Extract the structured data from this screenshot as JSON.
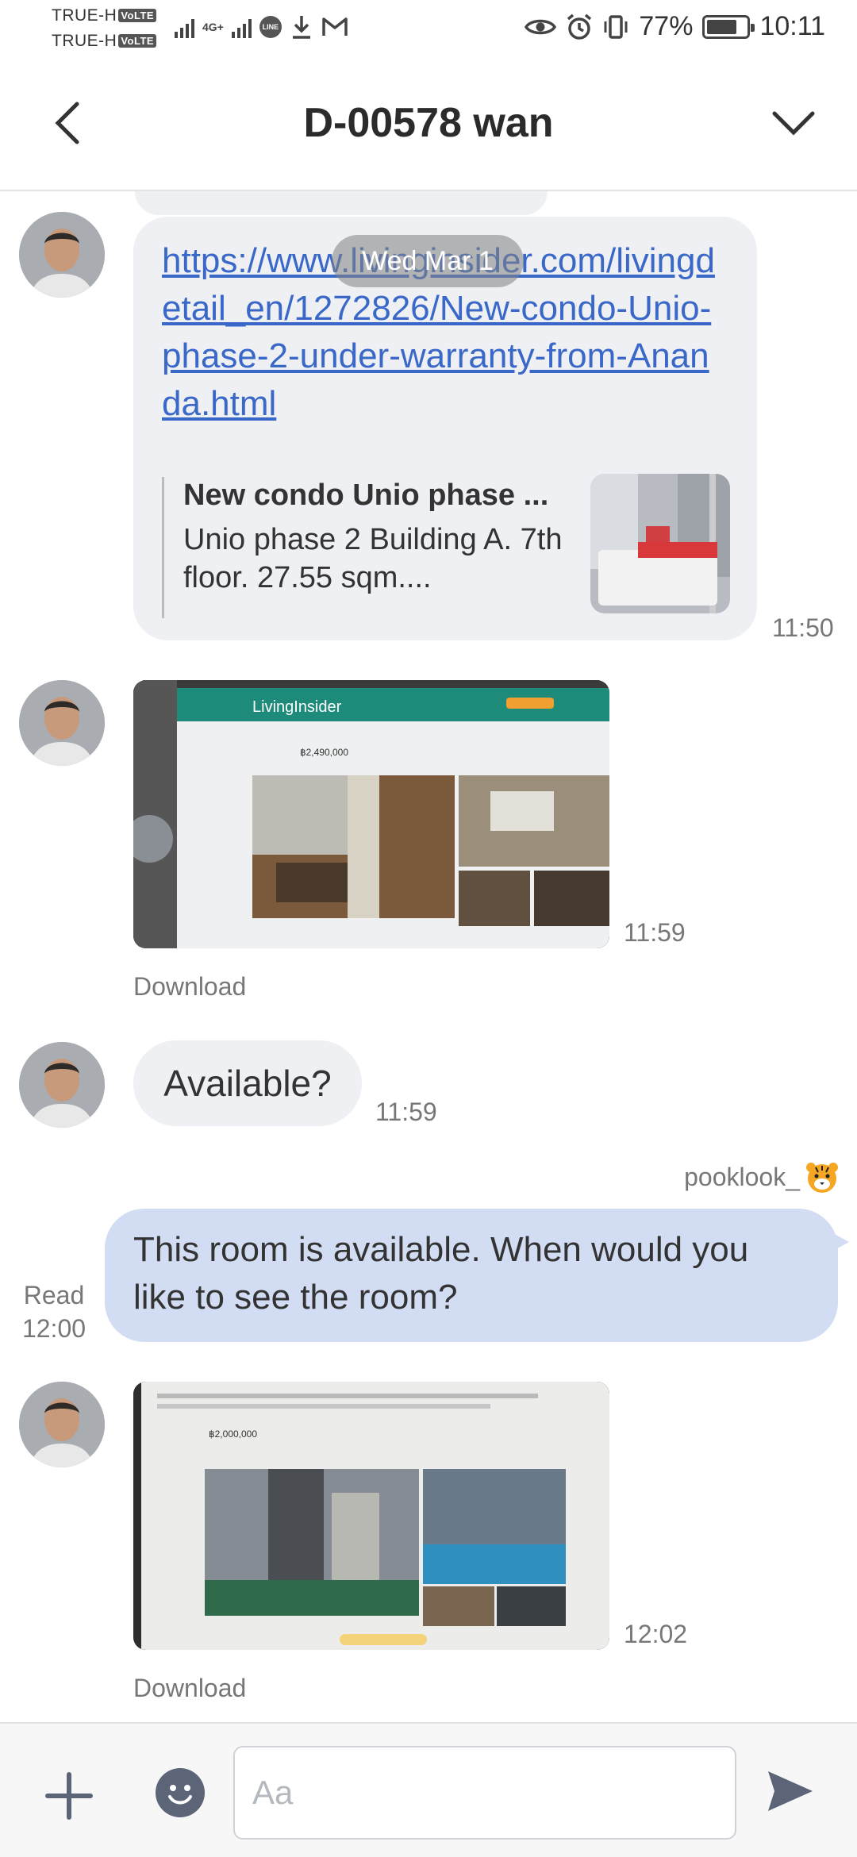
{
  "status_bar": {
    "carrier1": "TRUE-H",
    "carrier2": "TRUE-H",
    "volte": "VoLTE",
    "network": "4G+",
    "line_badge": "LINE",
    "battery": "77%",
    "battery_level": 0.77,
    "time": "10:11"
  },
  "header": {
    "title": "D-00578 wan"
  },
  "messages": {
    "link": {
      "url": "https://www.livinginsider.com/livingdetail_en/1272826/New-condo-Unio-phase-2-under-warranty-from-Ananda.html",
      "date_pill": "Wed Mar 1",
      "preview_title": "New condo Unio phase ...",
      "preview_desc": "Unio phase 2 Building A. 7th floor. 27.55 sqm....",
      "time": "11:50"
    },
    "image1": {
      "site_name": "LivingInsider",
      "price": "฿2,490,000",
      "time": "11:59",
      "download": "Download"
    },
    "text_in": {
      "text": "Available?",
      "time": "11:59"
    },
    "outgoing": {
      "sender": "pooklook_",
      "text": "This room is available. When would you like to see the room?",
      "read": "Read",
      "time": "12:00"
    },
    "image2": {
      "price": "฿2,000,000",
      "time": "12:02",
      "download": "Download"
    }
  },
  "input_bar": {
    "placeholder": "Aa"
  },
  "colors": {
    "link": "#3a68c9",
    "incoming_bubble": "#eef0f3",
    "outgoing_bubble": "#d2ddf4"
  }
}
